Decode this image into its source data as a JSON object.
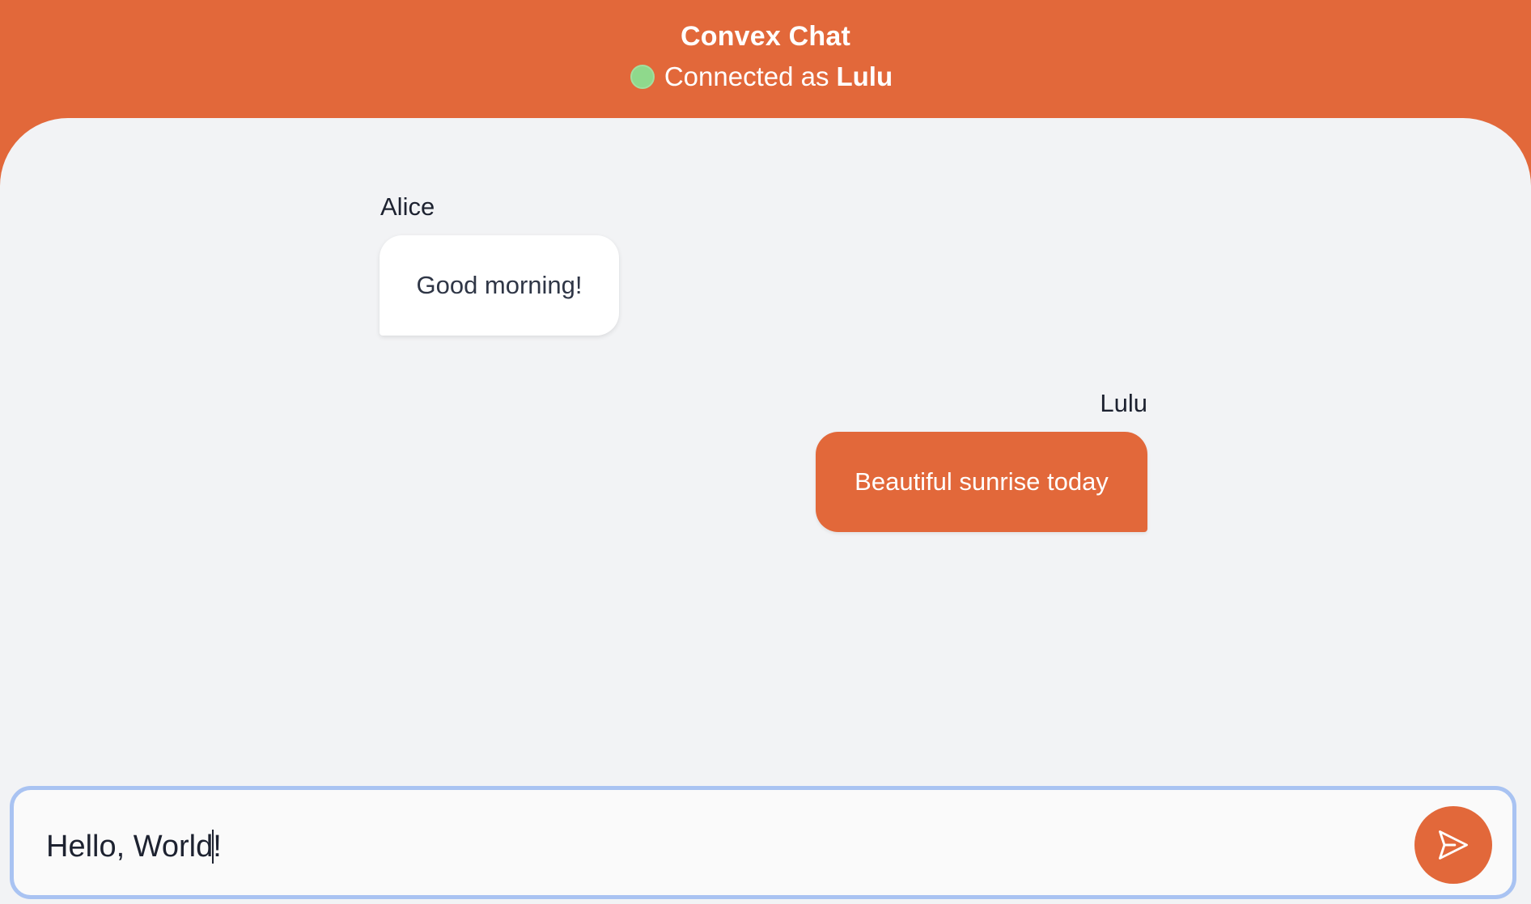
{
  "header": {
    "title": "Convex Chat",
    "status_text": "Connected as",
    "status_user": "Lulu",
    "status_color": "#8fd98c"
  },
  "messages": [
    {
      "author": "Alice",
      "text": "Good morning!",
      "direction": "incoming"
    },
    {
      "author": "Lulu",
      "text": "Beautiful sunrise today",
      "direction": "outgoing"
    }
  ],
  "composer": {
    "value": "Hello, World!",
    "send_icon": "send-icon"
  },
  "colors": {
    "accent": "#e2683a",
    "background": "#f2f3f5",
    "input_focus_border": "#a9c3f2"
  }
}
